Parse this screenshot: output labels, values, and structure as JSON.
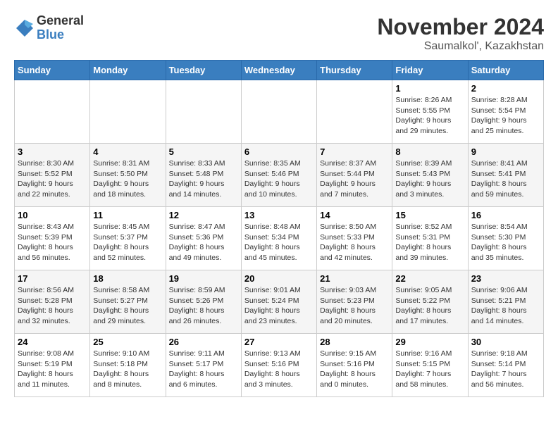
{
  "logo": {
    "general": "General",
    "blue": "Blue"
  },
  "header": {
    "month": "November 2024",
    "location": "Saumalkol', Kazakhstan"
  },
  "weekdays": [
    "Sunday",
    "Monday",
    "Tuesday",
    "Wednesday",
    "Thursday",
    "Friday",
    "Saturday"
  ],
  "weeks": [
    [
      {
        "day": "",
        "sunrise": "",
        "sunset": "",
        "daylight": ""
      },
      {
        "day": "",
        "sunrise": "",
        "sunset": "",
        "daylight": ""
      },
      {
        "day": "",
        "sunrise": "",
        "sunset": "",
        "daylight": ""
      },
      {
        "day": "",
        "sunrise": "",
        "sunset": "",
        "daylight": ""
      },
      {
        "day": "",
        "sunrise": "",
        "sunset": "",
        "daylight": ""
      },
      {
        "day": "1",
        "sunrise": "Sunrise: 8:26 AM",
        "sunset": "Sunset: 5:55 PM",
        "daylight": "Daylight: 9 hours and 29 minutes."
      },
      {
        "day": "2",
        "sunrise": "Sunrise: 8:28 AM",
        "sunset": "Sunset: 5:54 PM",
        "daylight": "Daylight: 9 hours and 25 minutes."
      }
    ],
    [
      {
        "day": "3",
        "sunrise": "Sunrise: 8:30 AM",
        "sunset": "Sunset: 5:52 PM",
        "daylight": "Daylight: 9 hours and 22 minutes."
      },
      {
        "day": "4",
        "sunrise": "Sunrise: 8:31 AM",
        "sunset": "Sunset: 5:50 PM",
        "daylight": "Daylight: 9 hours and 18 minutes."
      },
      {
        "day": "5",
        "sunrise": "Sunrise: 8:33 AM",
        "sunset": "Sunset: 5:48 PM",
        "daylight": "Daylight: 9 hours and 14 minutes."
      },
      {
        "day": "6",
        "sunrise": "Sunrise: 8:35 AM",
        "sunset": "Sunset: 5:46 PM",
        "daylight": "Daylight: 9 hours and 10 minutes."
      },
      {
        "day": "7",
        "sunrise": "Sunrise: 8:37 AM",
        "sunset": "Sunset: 5:44 PM",
        "daylight": "Daylight: 9 hours and 7 minutes."
      },
      {
        "day": "8",
        "sunrise": "Sunrise: 8:39 AM",
        "sunset": "Sunset: 5:43 PM",
        "daylight": "Daylight: 9 hours and 3 minutes."
      },
      {
        "day": "9",
        "sunrise": "Sunrise: 8:41 AM",
        "sunset": "Sunset: 5:41 PM",
        "daylight": "Daylight: 8 hours and 59 minutes."
      }
    ],
    [
      {
        "day": "10",
        "sunrise": "Sunrise: 8:43 AM",
        "sunset": "Sunset: 5:39 PM",
        "daylight": "Daylight: 8 hours and 56 minutes."
      },
      {
        "day": "11",
        "sunrise": "Sunrise: 8:45 AM",
        "sunset": "Sunset: 5:37 PM",
        "daylight": "Daylight: 8 hours and 52 minutes."
      },
      {
        "day": "12",
        "sunrise": "Sunrise: 8:47 AM",
        "sunset": "Sunset: 5:36 PM",
        "daylight": "Daylight: 8 hours and 49 minutes."
      },
      {
        "day": "13",
        "sunrise": "Sunrise: 8:48 AM",
        "sunset": "Sunset: 5:34 PM",
        "daylight": "Daylight: 8 hours and 45 minutes."
      },
      {
        "day": "14",
        "sunrise": "Sunrise: 8:50 AM",
        "sunset": "Sunset: 5:33 PM",
        "daylight": "Daylight: 8 hours and 42 minutes."
      },
      {
        "day": "15",
        "sunrise": "Sunrise: 8:52 AM",
        "sunset": "Sunset: 5:31 PM",
        "daylight": "Daylight: 8 hours and 39 minutes."
      },
      {
        "day": "16",
        "sunrise": "Sunrise: 8:54 AM",
        "sunset": "Sunset: 5:30 PM",
        "daylight": "Daylight: 8 hours and 35 minutes."
      }
    ],
    [
      {
        "day": "17",
        "sunrise": "Sunrise: 8:56 AM",
        "sunset": "Sunset: 5:28 PM",
        "daylight": "Daylight: 8 hours and 32 minutes."
      },
      {
        "day": "18",
        "sunrise": "Sunrise: 8:58 AM",
        "sunset": "Sunset: 5:27 PM",
        "daylight": "Daylight: 8 hours and 29 minutes."
      },
      {
        "day": "19",
        "sunrise": "Sunrise: 8:59 AM",
        "sunset": "Sunset: 5:26 PM",
        "daylight": "Daylight: 8 hours and 26 minutes."
      },
      {
        "day": "20",
        "sunrise": "Sunrise: 9:01 AM",
        "sunset": "Sunset: 5:24 PM",
        "daylight": "Daylight: 8 hours and 23 minutes."
      },
      {
        "day": "21",
        "sunrise": "Sunrise: 9:03 AM",
        "sunset": "Sunset: 5:23 PM",
        "daylight": "Daylight: 8 hours and 20 minutes."
      },
      {
        "day": "22",
        "sunrise": "Sunrise: 9:05 AM",
        "sunset": "Sunset: 5:22 PM",
        "daylight": "Daylight: 8 hours and 17 minutes."
      },
      {
        "day": "23",
        "sunrise": "Sunrise: 9:06 AM",
        "sunset": "Sunset: 5:21 PM",
        "daylight": "Daylight: 8 hours and 14 minutes."
      }
    ],
    [
      {
        "day": "24",
        "sunrise": "Sunrise: 9:08 AM",
        "sunset": "Sunset: 5:19 PM",
        "daylight": "Daylight: 8 hours and 11 minutes."
      },
      {
        "day": "25",
        "sunrise": "Sunrise: 9:10 AM",
        "sunset": "Sunset: 5:18 PM",
        "daylight": "Daylight: 8 hours and 8 minutes."
      },
      {
        "day": "26",
        "sunrise": "Sunrise: 9:11 AM",
        "sunset": "Sunset: 5:17 PM",
        "daylight": "Daylight: 8 hours and 6 minutes."
      },
      {
        "day": "27",
        "sunrise": "Sunrise: 9:13 AM",
        "sunset": "Sunset: 5:16 PM",
        "daylight": "Daylight: 8 hours and 3 minutes."
      },
      {
        "day": "28",
        "sunrise": "Sunrise: 9:15 AM",
        "sunset": "Sunset: 5:16 PM",
        "daylight": "Daylight: 8 hours and 0 minutes."
      },
      {
        "day": "29",
        "sunrise": "Sunrise: 9:16 AM",
        "sunset": "Sunset: 5:15 PM",
        "daylight": "Daylight: 7 hours and 58 minutes."
      },
      {
        "day": "30",
        "sunrise": "Sunrise: 9:18 AM",
        "sunset": "Sunset: 5:14 PM",
        "daylight": "Daylight: 7 hours and 56 minutes."
      }
    ]
  ]
}
